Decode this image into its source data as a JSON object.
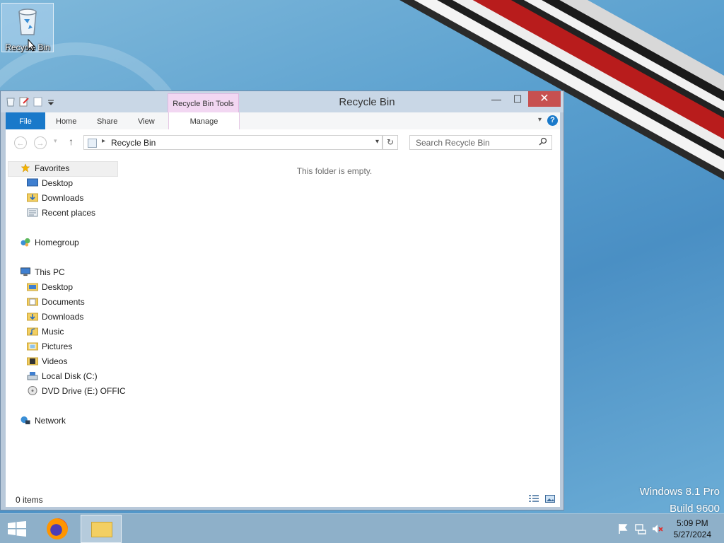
{
  "desktop": {
    "recycle_icon_label": "Recycle Bin",
    "watermark_line1": "Windows 8.1 Pro",
    "watermark_line2": "Build 9600"
  },
  "window": {
    "title": "Recycle Bin",
    "contextual_tab_group": "Recycle Bin Tools",
    "buttons": {
      "minimize": "—",
      "maximize": "☐",
      "close": "✕"
    }
  },
  "ribbon": {
    "tabs": [
      {
        "label": "File"
      },
      {
        "label": "Home"
      },
      {
        "label": "Share"
      },
      {
        "label": "View"
      },
      {
        "label": "Manage"
      }
    ],
    "help": "?"
  },
  "address_bar": {
    "back": "←",
    "forward": "→",
    "recent": "▾",
    "up": "↑",
    "separator": "▸",
    "path": "Recycle Bin",
    "dropdown": "▾",
    "refresh": "↻"
  },
  "search": {
    "placeholder": "Search Recycle Bin",
    "icon": "search-icon"
  },
  "nav_pane": {
    "favorites": {
      "label": "Favorites",
      "items": [
        {
          "label": "Desktop"
        },
        {
          "label": "Downloads"
        },
        {
          "label": "Recent places"
        }
      ]
    },
    "homegroup": {
      "label": "Homegroup"
    },
    "this_pc": {
      "label": "This PC",
      "items": [
        {
          "label": "Desktop"
        },
        {
          "label": "Documents"
        },
        {
          "label": "Downloads"
        },
        {
          "label": "Music"
        },
        {
          "label": "Pictures"
        },
        {
          "label": "Videos"
        },
        {
          "label": "Local Disk (C:)"
        },
        {
          "label": "DVD Drive (E:) OFFIC"
        }
      ]
    },
    "network": {
      "label": "Network"
    }
  },
  "content": {
    "empty_message": "This folder is empty."
  },
  "status_bar": {
    "count": "0 items"
  },
  "taskbar": {
    "time": "5:09 PM",
    "date": "5/27/2024"
  },
  "colors": {
    "accent": "#1979ca",
    "close_button": "#c75050",
    "contextual_tab": "#f2d7f2",
    "taskbar": "#8eb0c9"
  }
}
